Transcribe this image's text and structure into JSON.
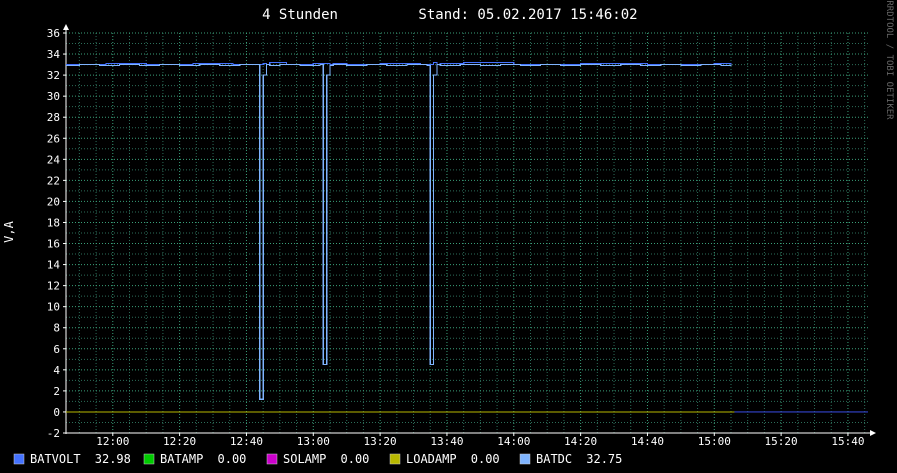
{
  "chart_data": {
    "type": "line",
    "title_period": "4 Stunden",
    "title_stamp": "Stand: 05.02.2017 15:46:02",
    "ylabel": "V,A",
    "watermark": "RRDTOOL / TOBI OETIKER",
    "ylim": [
      -2,
      36
    ],
    "y_major_step": 2,
    "xlim": [
      "11:46",
      "15:46"
    ],
    "x_ticks": [
      "12:00",
      "12:20",
      "12:40",
      "13:00",
      "13:20",
      "13:40",
      "14:00",
      "14:20",
      "14:40",
      "15:00",
      "15:20",
      "15:40"
    ],
    "grid": true,
    "legend_position": "bottom",
    "series": [
      {
        "name": "BATVOLT",
        "color": "#4472ff",
        "legend_value": "32.98",
        "x": [
          "11:46",
          "11:58",
          "12:10",
          "12:24",
          "12:36",
          "12:45",
          "12:46",
          "12:47",
          "12:52",
          "13:00",
          "13:05",
          "13:06",
          "13:10",
          "13:20",
          "13:32",
          "13:36",
          "13:37",
          "13:38",
          "13:45",
          "14:00",
          "14:20",
          "14:40",
          "15:00",
          "15:05"
        ],
        "values": [
          33.0,
          33.1,
          33.0,
          33.1,
          33.0,
          33.1,
          33.0,
          33.2,
          33.0,
          33.1,
          33.0,
          33.1,
          33.0,
          33.1,
          33.0,
          33.2,
          33.0,
          33.1,
          33.2,
          33.0,
          33.1,
          33.0,
          33.1,
          33.0
        ]
      },
      {
        "name": "BATAMP",
        "color": "#00cc00",
        "legend_value": "0.00"
      },
      {
        "name": "SOLAMP",
        "color": "#cc00cc",
        "legend_value": "0.00"
      },
      {
        "name": "LOADAMP",
        "color": "#b8b800",
        "legend_value": "0.00",
        "x": [
          "11:46",
          "15:06"
        ],
        "values": [
          0.0,
          0.0
        ]
      },
      {
        "name": "BATDC",
        "color": "#7fb4ff",
        "legend_value": "32.75",
        "x": [
          "11:46",
          "11:50",
          "11:56",
          "12:02",
          "12:08",
          "12:14",
          "12:20",
          "12:26",
          "12:32",
          "12:38",
          "12:44",
          "12:44",
          "12:45",
          "12:45",
          "12:46",
          "12:46",
          "12:47",
          "12:50",
          "12:56",
          "13:02",
          "13:03",
          "13:03",
          "13:04",
          "13:04",
          "13:05",
          "13:05",
          "13:06",
          "13:10",
          "13:16",
          "13:22",
          "13:28",
          "13:34",
          "13:35",
          "13:35",
          "13:36",
          "13:36",
          "13:37",
          "13:37",
          "13:38",
          "13:44",
          "13:50",
          "13:56",
          "14:02",
          "14:08",
          "14:14",
          "14:20",
          "14:26",
          "14:32",
          "14:38",
          "14:44",
          "14:50",
          "14:56",
          "15:02",
          "15:05"
        ],
        "values": [
          32.9,
          33.0,
          32.9,
          33.0,
          32.9,
          33.0,
          32.9,
          33.0,
          32.9,
          33.0,
          32.9,
          1.2,
          1.2,
          32.0,
          32.0,
          33.0,
          32.9,
          33.0,
          32.9,
          33.0,
          32.9,
          4.5,
          4.5,
          32.0,
          32.0,
          32.9,
          33.0,
          32.9,
          33.0,
          32.9,
          33.0,
          32.9,
          32.9,
          4.5,
          4.5,
          32.0,
          32.0,
          33.0,
          32.9,
          33.0,
          32.9,
          33.0,
          32.9,
          33.0,
          32.9,
          33.0,
          32.9,
          33.0,
          32.9,
          33.0,
          32.9,
          33.0,
          32.9,
          33.0
        ]
      }
    ],
    "after_data_line": {
      "from": "15:06",
      "to": "15:46",
      "value": 0.0,
      "color": "#3344cc"
    }
  },
  "colors": {
    "background": "#000000",
    "grid_minor": "#2c6e5a",
    "grid_major": "#3aa07a",
    "axis": "#ffffff"
  }
}
